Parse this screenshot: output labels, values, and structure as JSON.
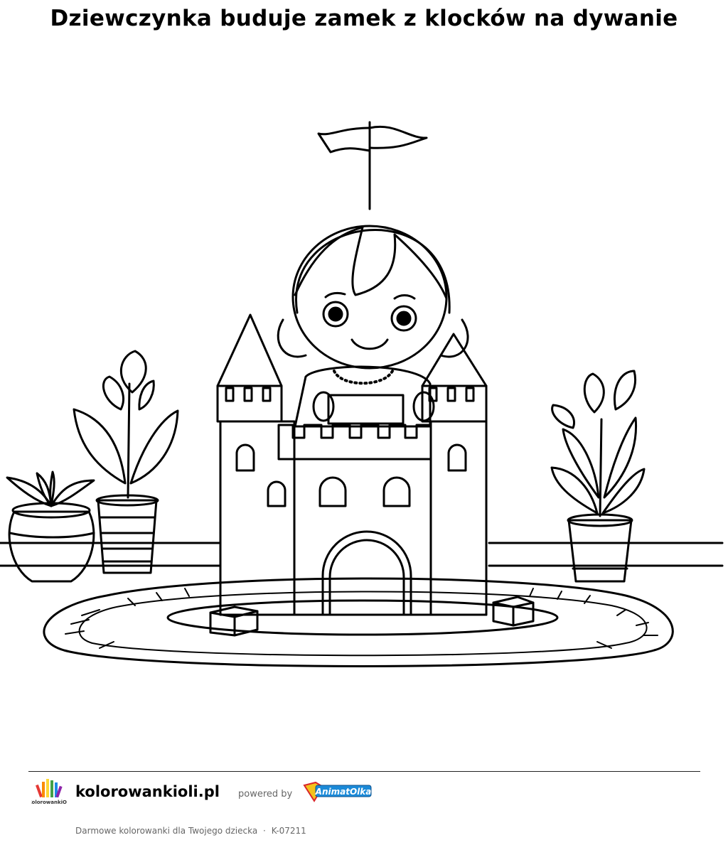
{
  "page": {
    "title": "Dziewczynka buduje zamek z klocków na dywanie"
  },
  "footer": {
    "site_name": "kolorowankioli.pl",
    "powered_by": "powered by",
    "partner_logo_text": "AnimatOlka",
    "logo_text": "KolorowankiOli",
    "tagline": "Darmowe kolorowanki dla Twojego dziecka",
    "separator": "·",
    "code": "K-07211"
  },
  "colors": {
    "line": "#000000",
    "muted": "#666666",
    "partner_blue": "#1b8ad8",
    "partner_red": "#d9262a",
    "partner_yellow": "#f3c21b"
  }
}
